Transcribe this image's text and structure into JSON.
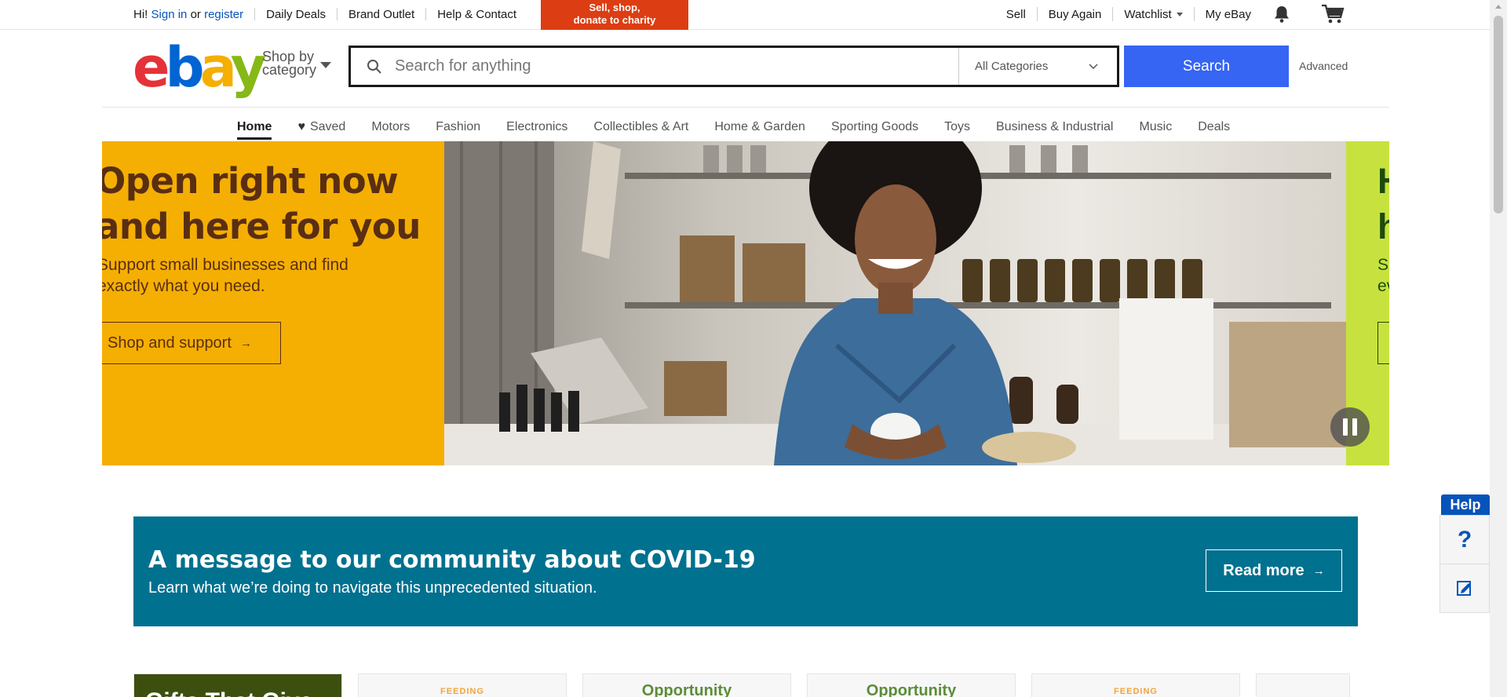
{
  "topbar": {
    "greeting": "Hi!",
    "sign_in": "Sign in",
    "or": "or",
    "register": "register",
    "daily_deals": "Daily Deals",
    "brand_outlet": "Brand Outlet",
    "help_contact": "Help & Contact",
    "promo_line1": "Sell, shop,",
    "promo_line2": "donate to charity",
    "sell": "Sell",
    "buy_again": "Buy Again",
    "watchlist": "Watchlist",
    "my_ebay": "My eBay"
  },
  "header": {
    "logo": [
      "e",
      "b",
      "a",
      "y"
    ],
    "shop_by_line1": "Shop by",
    "shop_by_line2": "category",
    "search_placeholder": "Search for anything",
    "category": "All Categories",
    "search_button": "Search",
    "advanced": "Advanced"
  },
  "nav": {
    "items": [
      "Home",
      "Saved",
      "Motors",
      "Fashion",
      "Electronics",
      "Collectibles & Art",
      "Home & Garden",
      "Sporting Goods",
      "Toys",
      "Business & Industrial",
      "Music",
      "Deals"
    ]
  },
  "hero": {
    "headline_line1": "Open right now",
    "headline_line2": "and here for you",
    "sub_line1": "Support small businesses and find",
    "sub_line2": "exactly what you need.",
    "button": "Shop and support",
    "next_headline_line1": "H",
    "next_headline_line2": "h",
    "next_sub_line1": "Su",
    "next_sub_line2": "ev"
  },
  "covid": {
    "title": "A message to our community about COVID-19",
    "subtitle": "Learn what we’re doing to navigate this unprecedented situation.",
    "button": "Read more"
  },
  "cards": {
    "first": "Gifts That Give",
    "feeding": "FEEDING",
    "opportunity": "Opportunity"
  },
  "help": {
    "tab": "Help",
    "question": "?"
  },
  "colors": {
    "ebay_red": "#e53238",
    "ebay_blue": "#0064d2",
    "ebay_yellow": "#f5af02",
    "ebay_green": "#86b817",
    "search_blue": "#3665f3",
    "promo_orange": "#dd3d12",
    "covid_teal": "#00718f",
    "hero_yellow": "#f5af02",
    "hero_green": "#c7e23e"
  }
}
